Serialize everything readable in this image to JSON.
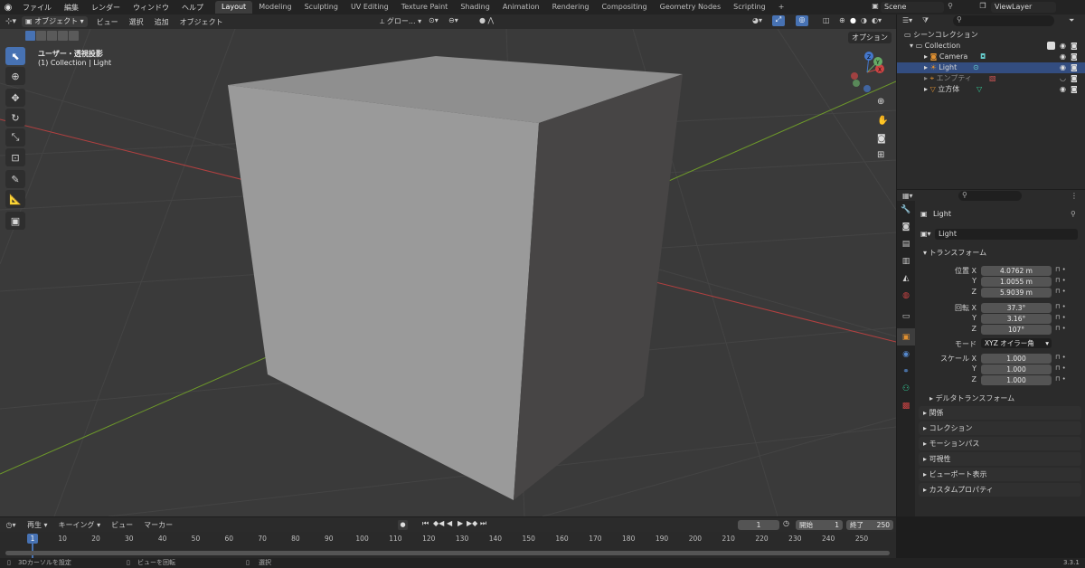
{
  "menu": {
    "items": [
      "ファイル",
      "編集",
      "レンダー",
      "ウィンドウ",
      "ヘルプ"
    ],
    "workspaces": [
      "Layout",
      "Modeling",
      "Sculpting",
      "UV Editing",
      "Texture Paint",
      "Shading",
      "Animation",
      "Rendering",
      "Compositing",
      "Geometry Nodes",
      "Scripting"
    ],
    "active_workspace": "Layout",
    "add_tab": "+",
    "scene": "Scene",
    "view_layer": "ViewLayer"
  },
  "viewport_header": {
    "mode": "オブジェクト",
    "menus": [
      "ビュー",
      "選択",
      "追加",
      "オブジェクト"
    ],
    "orientation": "グロー...",
    "options": "オプション"
  },
  "viewport": {
    "view_name": "ユーザー・透視投影",
    "collection_info": "(1) Collection | Light",
    "gizmo_labels": {
      "x": "X",
      "y": "Y",
      "z": "Z"
    }
  },
  "outliner": {
    "root": "シーンコレクション",
    "collection": "Collection",
    "items": [
      {
        "name": "Camera",
        "icon": "camera-icon"
      },
      {
        "name": "Light",
        "icon": "light-icon",
        "selected": true
      },
      {
        "name": "エンプティ",
        "icon": "empty-icon"
      },
      {
        "name": "立方体",
        "icon": "mesh-icon"
      }
    ]
  },
  "properties": {
    "object_name": "Light",
    "datablock_name": "Light",
    "transform_panel": "トランスフォーム",
    "location": {
      "label": "位置 X",
      "x": "4.0762 m",
      "y": "1.0055 m",
      "z": "5.9039 m"
    },
    "rotation": {
      "label": "回転 X",
      "x": "37.3°",
      "y": "3.16°",
      "z": "107°"
    },
    "mode_label": "モード",
    "mode_value": "XYZ オイラー角",
    "scale": {
      "label": "スケール X",
      "x": "1.000",
      "y": "1.000",
      "z": "1.000"
    },
    "axis_y": "Y",
    "axis_z": "Z",
    "delta_transform": "デルタトランスフォーム",
    "panels": [
      "関係",
      "コレクション",
      "モーションパス",
      "可視性",
      "ビューポート表示",
      "カスタムプロパティ"
    ]
  },
  "timeline": {
    "menus": [
      "再生",
      "キーイング",
      "ビュー",
      "マーカー"
    ],
    "current_frame": "1",
    "start_label": "開始",
    "start_value": "1",
    "end_label": "終了",
    "end_value": "250",
    "ticks": [
      "1",
      "10",
      "20",
      "30",
      "40",
      "50",
      "60",
      "70",
      "80",
      "90",
      "100",
      "110",
      "120",
      "130",
      "140",
      "150",
      "160",
      "170",
      "180",
      "190",
      "200",
      "210",
      "220",
      "230",
      "240",
      "250"
    ]
  },
  "statusbar": {
    "left": "3Dカーソルを設定",
    "middle": "ビューを回転",
    "right": "選択",
    "version": "3.3.1"
  },
  "colors": {
    "accent": "#4772b3",
    "selection": "#334d80",
    "x_axis": "#b34040",
    "y_axis": "#6e9a2a",
    "cube_light": "#9a9a9a",
    "cube_dark": "#474545"
  }
}
